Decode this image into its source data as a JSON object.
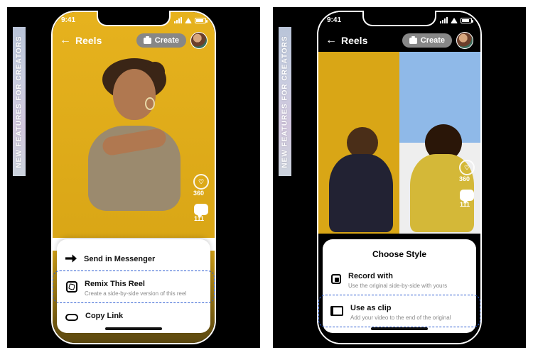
{
  "badge_text": "NEW FEATURES FOR CREATORS",
  "status_time": "9:41",
  "nav": {
    "back_icon": "←",
    "title": "Reels",
    "create_label": "Create"
  },
  "stats": {
    "likes": "360",
    "comments": "111"
  },
  "sheet1": {
    "items": [
      {
        "title": "Send in Messenger",
        "sub": ""
      },
      {
        "title": "Remix This Reel",
        "sub": "Create a side-by-side version of this reel"
      },
      {
        "title": "Copy Link",
        "sub": ""
      }
    ]
  },
  "sheet2": {
    "title": "Choose Style",
    "items": [
      {
        "title": "Record with",
        "sub": "Use the original side-by-side with yours"
      },
      {
        "title": "Use as clip",
        "sub": "Add your video to the end of the original"
      }
    ]
  }
}
